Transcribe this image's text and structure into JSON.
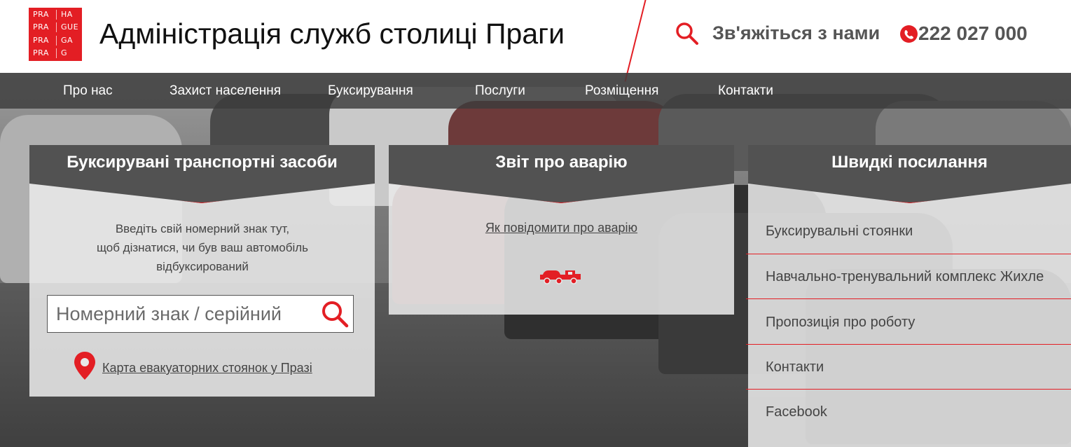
{
  "header": {
    "logo_lines": [
      [
        "PRA",
        "HA"
      ],
      [
        "PRA",
        "GUE"
      ],
      [
        "PRA",
        "GA"
      ],
      [
        "PRA",
        "G"
      ]
    ],
    "title": "Адміністрація служб столиці Праги",
    "contact_label": "Зв'яжіться з нами",
    "phone": "222 027 000"
  },
  "nav": {
    "items": [
      "Про нас",
      "Захист населення",
      "Буксирування",
      "Послуги",
      "Розміщення",
      "Контакти"
    ]
  },
  "towed_panel": {
    "title": "Буксирувані транспортні засоби",
    "description_lines": [
      "Введіть свій номерний знак тут,",
      "щоб дізнатися, чи був ваш автомобіль",
      "відбуксирований"
    ],
    "input_placeholder": "Номерний знак / серійний",
    "map_link": "Карта евакуаторних стоянок у Празі"
  },
  "accident_panel": {
    "title": "Звіт про аварію",
    "link": "Як повідомити про аварію"
  },
  "quick_links": {
    "title": "Швидкі посилання",
    "items": [
      "Буксирувальні стоянки",
      "Навчально-тренувальний комплекс Жихле",
      "Пропозиція про роботу",
      "Контакти",
      "Facebook"
    ]
  },
  "colors": {
    "accent": "#e31e24",
    "panel_head": "#525252",
    "nav_bg": "#3c3c3c"
  },
  "icons": [
    "search-icon",
    "phone-icon",
    "location-pin-icon",
    "tow-truck-icon"
  ]
}
